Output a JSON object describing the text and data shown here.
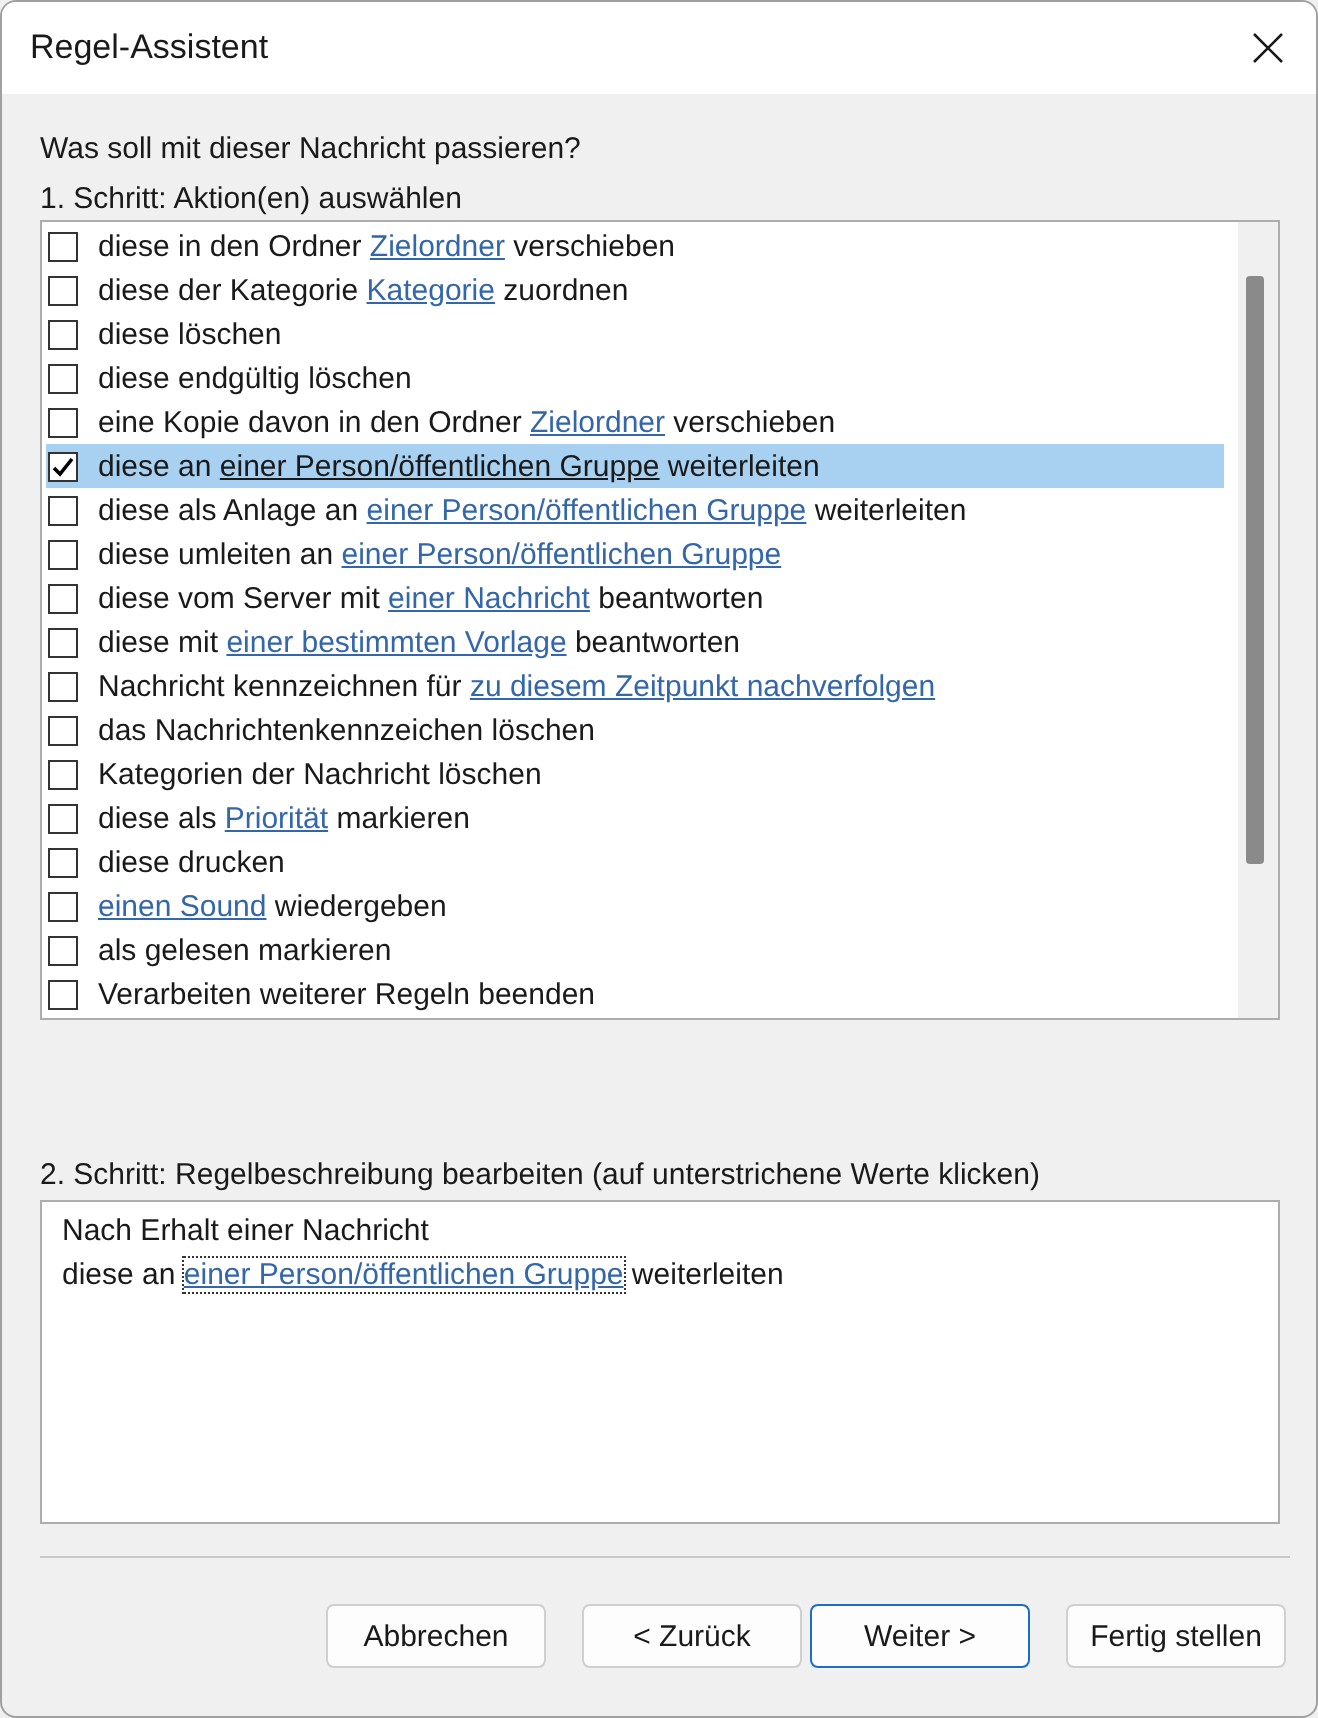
{
  "window": {
    "title": "Regel-Assistent"
  },
  "question": "Was soll mit dieser Nachricht passieren?",
  "step1": {
    "label": "1. Schritt: Aktion(en) auswählen",
    "actions": [
      {
        "before": "diese in den Ordner ",
        "link": "Zielordner",
        "after": " verschieben",
        "checked": false,
        "selected": false
      },
      {
        "before": "diese der Kategorie ",
        "link": "Kategorie",
        "after": " zuordnen",
        "checked": false,
        "selected": false
      },
      {
        "before": "diese löschen",
        "checked": false,
        "selected": false
      },
      {
        "before": "diese endgültig löschen",
        "checked": false,
        "selected": false
      },
      {
        "before": "eine Kopie davon in den Ordner ",
        "link": "Zielordner",
        "after": " verschieben",
        "checked": false,
        "selected": false
      },
      {
        "before": "diese an ",
        "link": "einer Person/öffentlichen Gruppe",
        "after": " weiterleiten",
        "checked": true,
        "selected": true
      },
      {
        "before": "diese als Anlage an ",
        "link": "einer Person/öffentlichen Gruppe",
        "after": " weiterleiten",
        "checked": false,
        "selected": false
      },
      {
        "before": "diese umleiten an ",
        "link": "einer Person/öffentlichen Gruppe",
        "checked": false,
        "selected": false
      },
      {
        "before": "diese vom Server mit ",
        "link": "einer Nachricht",
        "after": " beantworten",
        "checked": false,
        "selected": false
      },
      {
        "before": "diese mit ",
        "link": "einer bestimmten Vorlage",
        "after": " beantworten",
        "checked": false,
        "selected": false
      },
      {
        "before": "Nachricht kennzeichnen für ",
        "link": "zu diesem Zeitpunkt nachverfolgen",
        "checked": false,
        "selected": false
      },
      {
        "before": "das Nachrichtenkennzeichen löschen",
        "checked": false,
        "selected": false
      },
      {
        "before": "Kategorien der Nachricht löschen",
        "checked": false,
        "selected": false
      },
      {
        "before": "diese als ",
        "link": "Priorität",
        "after": " markieren",
        "checked": false,
        "selected": false
      },
      {
        "before": "diese drucken",
        "checked": false,
        "selected": false
      },
      {
        "link": "einen Sound",
        "after": " wiedergeben",
        "checked": false,
        "selected": false
      },
      {
        "before": "als gelesen markieren",
        "checked": false,
        "selected": false
      },
      {
        "before": "Verarbeiten weiterer Regeln beenden",
        "checked": false,
        "selected": false
      }
    ]
  },
  "step2": {
    "label": "2. Schritt: Regelbeschreibung bearbeiten (auf unterstrichene Werte klicken)",
    "lines": [
      {
        "before": "Nach Erhalt einer Nachricht"
      },
      {
        "before": "diese an ",
        "link": "einer Person/öffentlichen Gruppe",
        "after": " weiterleiten"
      }
    ]
  },
  "buttons": [
    {
      "label": "Abbrechen",
      "default": false
    },
    {
      "label": "< Zurück",
      "default": false
    },
    {
      "label": "Weiter >",
      "default": true
    },
    {
      "label": "Fertig stellen",
      "default": false
    }
  ]
}
